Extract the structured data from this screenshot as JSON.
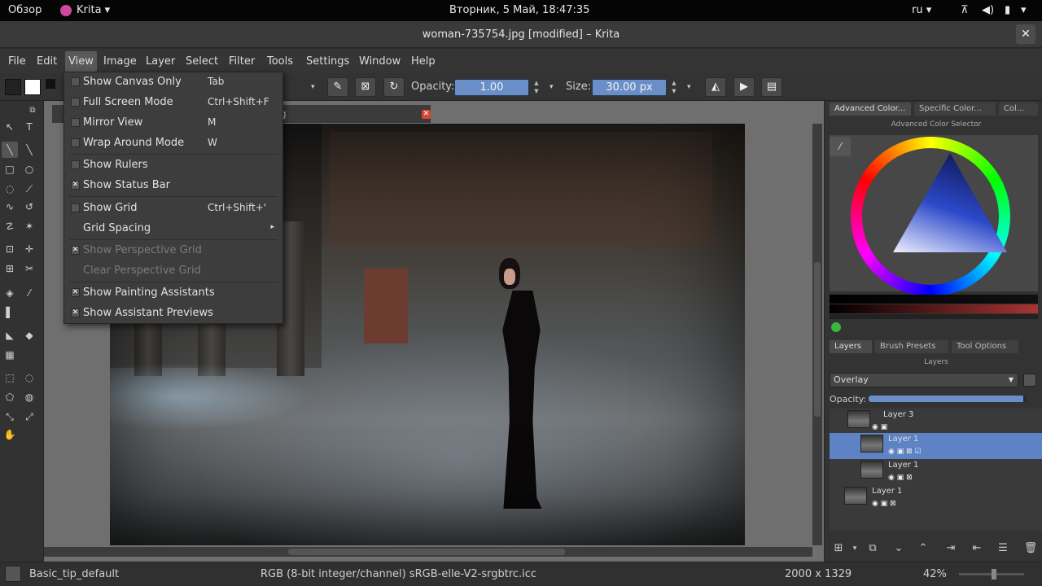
{
  "system_bar": {
    "overview": "Обзор",
    "app": "Krita ▾",
    "datetime": "Вторник, 5 Май, 18:47:35",
    "lang": "ru ▾"
  },
  "window": {
    "title": "woman-735754.jpg [modified] – Krita",
    "close": "✕"
  },
  "menubar": {
    "items": [
      "File",
      "Edit",
      "View",
      "Image",
      "Layer",
      "Select",
      "Filter",
      "Tools",
      "Settings",
      "Window",
      "Help"
    ]
  },
  "tool_options": {
    "opacity_label": "Opacity:",
    "opacity_value": "1.00",
    "size_label": "Size:",
    "size_value": "30.00 px"
  },
  "canvas": {
    "tab_label": "g"
  },
  "view_menu": {
    "items": [
      {
        "label": "Show Canvas Only",
        "shortcut": "Tab",
        "checked": false,
        "enabled": true
      },
      {
        "label": "Full Screen Mode",
        "shortcut": "Ctrl+Shift+F",
        "checked": false,
        "enabled": true
      },
      {
        "label": "Mirror View",
        "shortcut": "M",
        "checked": false,
        "enabled": true
      },
      {
        "label": "Wrap Around Mode",
        "shortcut": "W",
        "checked": false,
        "enabled": true
      },
      {
        "label": "Show Rulers",
        "shortcut": "",
        "checked": false,
        "enabled": true
      },
      {
        "label": "Show Status Bar",
        "shortcut": "",
        "checked": true,
        "enabled": true
      },
      {
        "label": "Show Grid",
        "shortcut": "Ctrl+Shift+'",
        "checked": false,
        "enabled": true
      },
      {
        "label": "Grid Spacing",
        "shortcut": "",
        "checked": false,
        "enabled": true,
        "submenu": true
      },
      {
        "label": "Show Perspective Grid",
        "shortcut": "",
        "checked": true,
        "enabled": false
      },
      {
        "label": "Clear Perspective Grid",
        "shortcut": "",
        "checked": false,
        "enabled": false
      },
      {
        "label": "Show Painting Assistants",
        "shortcut": "",
        "checked": true,
        "enabled": true
      },
      {
        "label": "Show Assistant Previews",
        "shortcut": "",
        "checked": true,
        "enabled": true
      }
    ]
  },
  "docker": {
    "color_tabs": [
      "Advanced Color...",
      "Specific Color...",
      "Col..."
    ],
    "color_title": "Advanced Color Selector",
    "layer_tabs": [
      "Layers",
      "Brush Presets",
      "Tool Options"
    ],
    "layers_title": "Layers",
    "blend_mode": "Overlay",
    "opacity_label": "Opacity:",
    "opacity_fraction": 0.98,
    "layers": [
      {
        "name": "Layer 3",
        "selected": false
      },
      {
        "name": "Layer 1",
        "selected": true
      },
      {
        "name": "Layer 1",
        "selected": false
      },
      {
        "name": "Layer 1",
        "selected": false
      }
    ]
  },
  "statusbar": {
    "brush": "Basic_tip_default",
    "color_profile": "RGB (8-bit integer/channel)  sRGB-elle-V2-srgbtrc.icc",
    "dimensions": "2000 x 1329",
    "zoom": "42%"
  }
}
